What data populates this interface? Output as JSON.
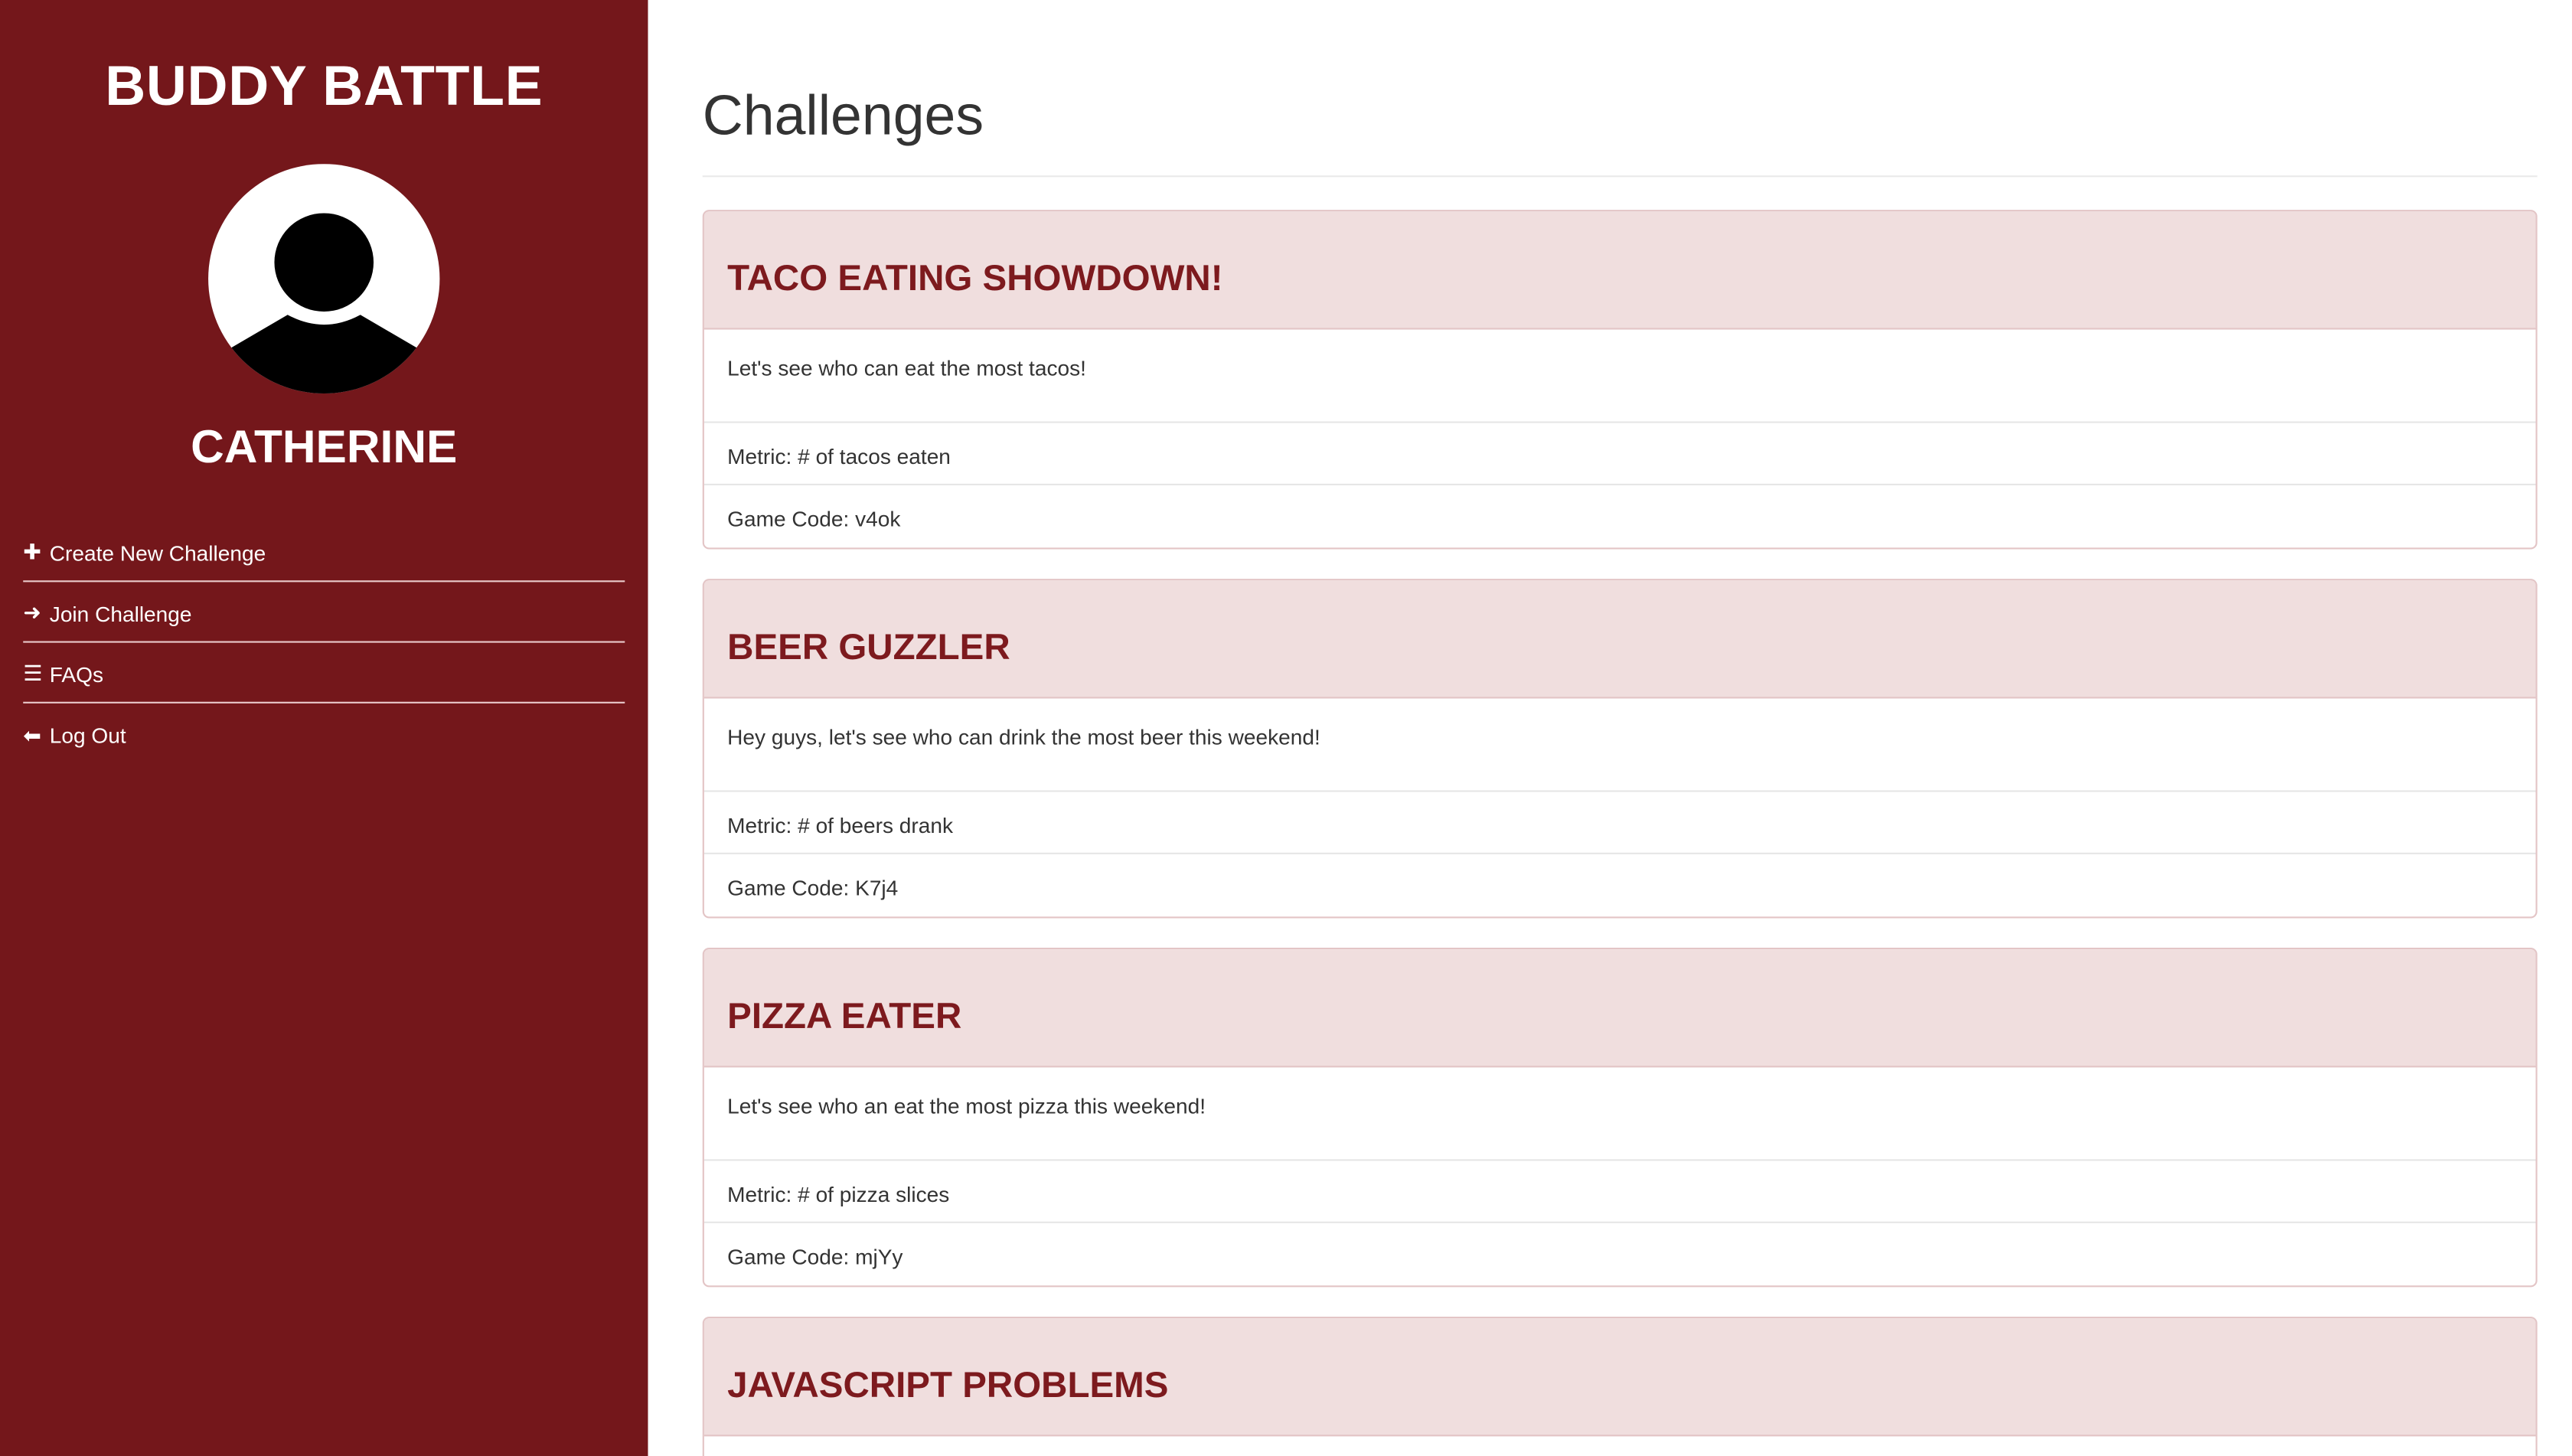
{
  "sidebar": {
    "brand": "BUDDY BATTLE",
    "username": "CATHERINE",
    "avatar_icon": "user-silhouette-icon",
    "nav": [
      {
        "icon": "plus-icon",
        "label": "Create New Challenge"
      },
      {
        "icon": "arrow-right-icon",
        "label": "Join Challenge"
      },
      {
        "icon": "list-icon",
        "label": "FAQs"
      },
      {
        "icon": "arrow-left-icon",
        "label": "Log Out"
      }
    ]
  },
  "main": {
    "title": "Challenges",
    "challenges": [
      {
        "title": "TACO EATING SHOWDOWN!",
        "description": "Let's see who can eat the most tacos!",
        "metric": "Metric: # of tacos eaten",
        "game_code": "Game Code: v4ok"
      },
      {
        "title": "BEER GUZZLER",
        "description": "Hey guys, let's see who can drink the most beer this weekend!",
        "metric": "Metric: # of beers drank",
        "game_code": "Game Code: K7j4"
      },
      {
        "title": "PIZZA EATER",
        "description": "Let's see who an eat the most pizza this weekend!",
        "metric": "Metric: # of pizza slices",
        "game_code": "Game Code: mjYy"
      },
      {
        "title": "JAVASCRIPT PROBLEMS"
      }
    ]
  },
  "colors": {
    "sidebar_bg": "#74171b",
    "card_header_bg": "#f0dede",
    "card_title": "#7d1a1e"
  }
}
